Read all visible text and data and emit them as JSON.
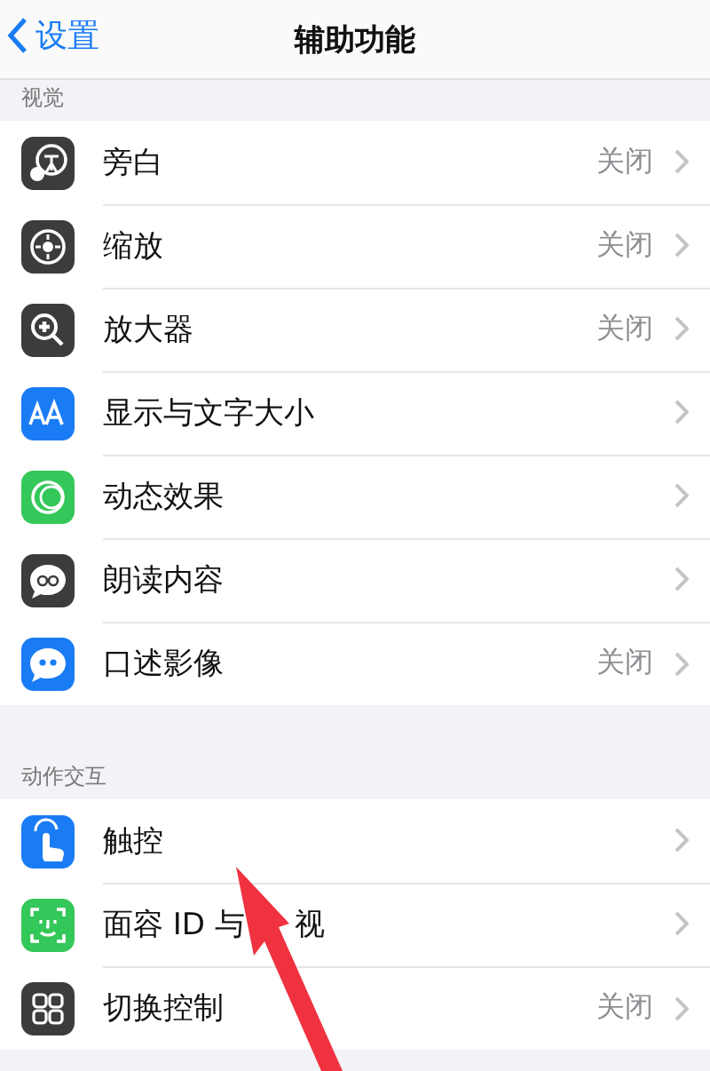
{
  "nav": {
    "back": "设置",
    "title": "辅助功能"
  },
  "sections": [
    {
      "header": "视觉",
      "rows": [
        {
          "label": "旁白",
          "value": "关闭",
          "color": "#3c3c3e"
        },
        {
          "label": "缩放",
          "value": "关闭",
          "color": "#3c3c3e"
        },
        {
          "label": "放大器",
          "value": "关闭",
          "color": "#3c3c3e"
        },
        {
          "label": "显示与文字大小",
          "color": "#1a7cf5"
        },
        {
          "label": "动态效果",
          "color": "#34c759"
        },
        {
          "label": "朗读内容",
          "color": "#3c3c3e"
        },
        {
          "label": "口述影像",
          "value": "关闭",
          "color": "#1a7cf5"
        }
      ]
    },
    {
      "header": "动作交互",
      "rows": [
        {
          "label": "触控",
          "color": "#1a7cf5"
        },
        {
          "label": "面容 ID 与",
          "label_tail": "视",
          "color": "#34c759"
        },
        {
          "label": "切换控制",
          "value": "关闭",
          "color": "#3c3c3e"
        }
      ]
    }
  ]
}
